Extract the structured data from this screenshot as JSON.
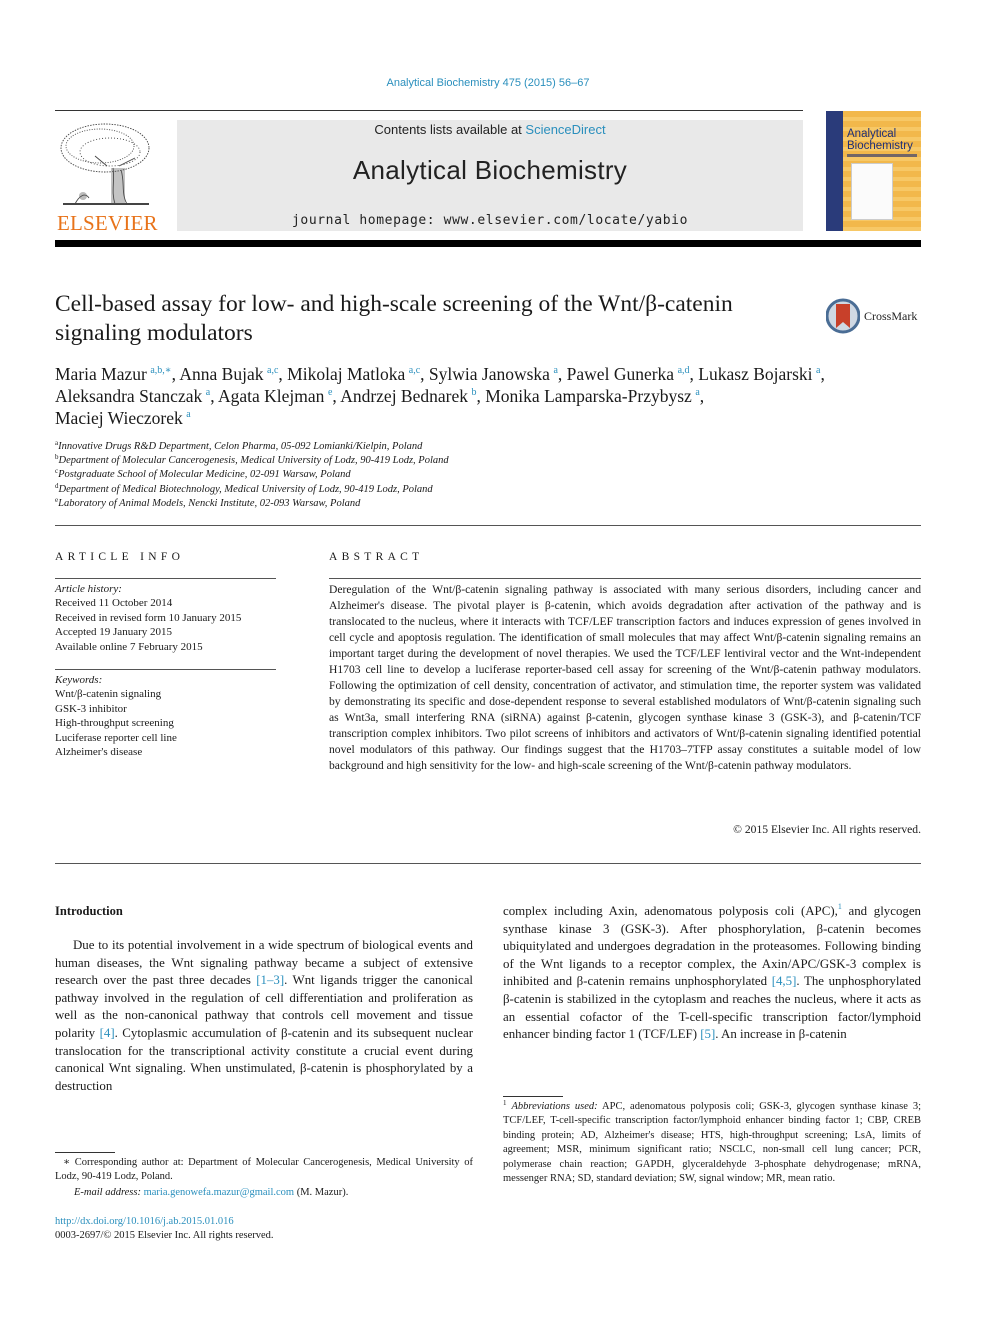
{
  "running_header": "Analytical Biochemistry 475 (2015) 56–67",
  "masthead": {
    "contents_prefix": "Contents lists available at ",
    "contents_link": "ScienceDirect",
    "journal_name": "Analytical Biochemistry",
    "homepage": "journal homepage: www.elsevier.com/locate/yabio"
  },
  "publisher_logo_text": "ELSEVIER",
  "cover": {
    "title_line1": "Analytical",
    "title_line2": "Biochemistry"
  },
  "crossmark_label": "CrossMark",
  "article": {
    "title": "Cell-based assay for low- and high-scale screening of the Wnt/β-catenin signaling modulators",
    "authors": [
      {
        "name": "Maria Mazur",
        "aff": "a,b,∗",
        "sep": ", "
      },
      {
        "name": "Anna Bujak",
        "aff": "a,c",
        "sep": ", "
      },
      {
        "name": "Mikolaj Matloka",
        "aff": "a,c",
        "sep": ", "
      },
      {
        "name": "Sylwia Janowska",
        "aff": "a",
        "sep": ", "
      },
      {
        "name": "Pawel Gunerka",
        "aff": "a,d",
        "sep": ", "
      },
      {
        "name": "Lukasz Bojarski",
        "aff": "a",
        "sep": ", "
      },
      {
        "name": "Aleksandra Stanczak",
        "aff": "a",
        "sep": ", "
      },
      {
        "name": "Agata Klejman",
        "aff": "e",
        "sep": ", "
      },
      {
        "name": "Andrzej Bednarek",
        "aff": "b",
        "sep": ", "
      },
      {
        "name": "Monika Lamparska-Przybysz",
        "aff": "a",
        "sep": ","
      },
      {
        "name": "Maciej Wieczorek",
        "aff": "a",
        "sep": ""
      }
    ],
    "affiliations": [
      {
        "key": "a",
        "text": "Innovative Drugs R&D Department, Celon Pharma, 05-092 Lomianki/Kielpin, Poland"
      },
      {
        "key": "b",
        "text": "Department of Molecular Cancerogenesis, Medical University of Lodz, 90-419 Lodz, Poland"
      },
      {
        "key": "c",
        "text": "Postgraduate School of Molecular Medicine, 02-091 Warsaw, Poland"
      },
      {
        "key": "d",
        "text": "Department of Medical Biotechnology, Medical University of Lodz, 90-419 Lodz, Poland"
      },
      {
        "key": "e",
        "text": "Laboratory of Animal Models, Nencki Institute, 02-093 Warsaw, Poland"
      }
    ]
  },
  "article_info": {
    "heading": "ARTICLE INFO",
    "history_label": "Article history:",
    "history": [
      "Received 11 October 2014",
      "Received in revised form 10 January 2015",
      "Accepted 19 January 2015",
      "Available online 7 February 2015"
    ],
    "keywords_label": "Keywords:",
    "keywords": [
      "Wnt/β-catenin signaling",
      "GSK-3 inhibitor",
      "High-throughput screening",
      "Luciferase reporter cell line",
      "Alzheimer's disease"
    ]
  },
  "abstract": {
    "heading": "ABSTRACT",
    "text": "Deregulation of the Wnt/β-catenin signaling pathway is associated with many serious disorders, including cancer and Alzheimer's disease. The pivotal player is β-catenin, which avoids degradation after activation of the pathway and is translocated to the nucleus, where it interacts with TCF/LEF transcription factors and induces expression of genes involved in cell cycle and apoptosis regulation. The identification of small molecules that may affect Wnt/β-catenin signaling remains an important target during the development of novel therapies. We used the TCF/LEF lentiviral vector and the Wnt-independent H1703 cell line to develop a luciferase reporter-based cell assay for screening of the Wnt/β-catenin pathway modulators. Following the optimization of cell density, concentration of activator, and stimulation time, the reporter system was validated by demonstrating its specific and dose-dependent response to several established modulators of Wnt/β-catenin signaling such as Wnt3a, small interfering RNA (siRNA) against β-catenin, glycogen synthase kinase 3 (GSK-3), and β-catenin/TCF transcription complex inhibitors. Two pilot screens of inhibitors and activators of Wnt/β-catenin signaling identified potential novel modulators of this pathway. Our findings suggest that the H1703–7TFP assay constitutes a suitable model of low background and high sensitivity for the low- and high-scale screening of the Wnt/β-catenin pathway modulators.",
    "copyright": "© 2015 Elsevier Inc. All rights reserved."
  },
  "introduction": {
    "heading": "Introduction",
    "left_parts": [
      {
        "t": "Due to its potential involvement in a wide spectrum of biological events and human diseases, the Wnt signaling pathway became a subject of extensive research over the past three decades "
      },
      {
        "ref": "[1–3]"
      },
      {
        "t": ". Wnt ligands trigger the canonical pathway involved in the regulation of cell differentiation and proliferation as well as the non-canonical pathway that controls cell movement and tissue polarity "
      },
      {
        "ref": "[4]"
      },
      {
        "t": ". Cytoplasmic accumulation of β-catenin and its subsequent nuclear translocation for the transcriptional activity constitute a crucial event during canonical Wnt signaling. When unstimulated, β-catenin is phosphorylated by a destruction"
      }
    ],
    "right_parts": [
      {
        "t": "complex including Axin, adenomatous polyposis coli (APC),"
      },
      {
        "sup": "1"
      },
      {
        "t": " and glycogen synthase kinase 3 (GSK-3). After phosphorylation, β-catenin becomes ubiquitylated and undergoes degradation in the proteasomes. Following binding of the Wnt ligands to a receptor complex, the Axin/APC/GSK-3 complex is inhibited and β-catenin remains unphosphorylated "
      },
      {
        "ref": "[4,5]"
      },
      {
        "t": ". The unphosphorylated β-catenin is stabilized in the cytoplasm and reaches the nucleus, where it acts as an essential cofactor of the T-cell-specific transcription factor/lymphoid enhancer binding factor 1 (TCF/LEF) "
      },
      {
        "ref": "[5]"
      },
      {
        "t": ". An increase in β-catenin"
      }
    ]
  },
  "footnotes": {
    "corresponding": "∗ Corresponding author at: Department of Molecular Cancerogenesis, Medical University of Lodz, 90-419 Lodz, Poland.",
    "email_label": "E-mail address: ",
    "email": "maria.genowefa.mazur@gmail.com",
    "email_suffix": " (M. Mazur).",
    "abbrev_mark": "1",
    "abbrev_label": "Abbreviations used:",
    "abbrev_text": " APC, adenomatous polyposis coli; GSK-3, glycogen synthase kinase 3; TCF/LEF, T-cell-specific transcription factor/lymphoid enhancer binding factor 1; CBP, CREB binding protein; AD, Alzheimer's disease; HTS, high-throughput screening; LsA, limits of agreement; MSR, minimum significant ratio; NSCLC, non-small cell lung cancer; PCR, polymerase chain reaction; GAPDH, glyceraldehyde 3-phosphate dehydrogenase; mRNA, messenger RNA; SD, standard deviation; SW, signal window; MR, mean ratio.",
    "doi": "http://dx.doi.org/10.1016/j.ab.2015.01.016",
    "issn": "0003-2697/© 2015 Elsevier Inc. All rights reserved."
  },
  "colors": {
    "link": "#2a8fbd",
    "elsevier_orange": "#e8731a",
    "masthead_gray": "#e9e9e9"
  }
}
